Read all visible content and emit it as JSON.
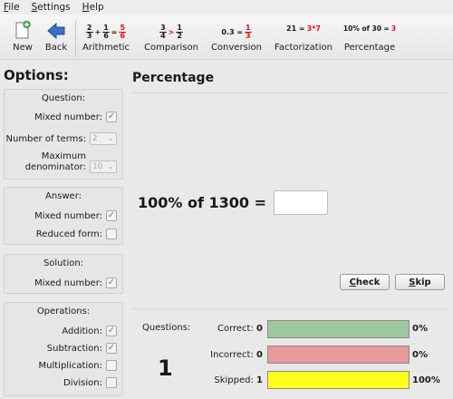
{
  "menu": {
    "file": "File",
    "settings": "Settings",
    "help": "Help"
  },
  "toolbar": {
    "new_label": "New",
    "back_label": "Back",
    "arithmetic_label": "Arithmetic",
    "comparison_label": "Comparison",
    "conversion_label": "Conversion",
    "factorization_label": "Factorization",
    "percentage_label": "Percentage",
    "arith_icon": {
      "a_num": "2",
      "a_den": "3",
      "op": "+",
      "b_num": "1",
      "b_den": "6",
      "eq": "=",
      "r_num": "5",
      "r_den": "6"
    },
    "comp_icon": {
      "a_num": "3",
      "a_den": "4",
      "op": ">",
      "b_num": "1",
      "b_den": "2"
    },
    "conv_icon": {
      "lhs": "0.3 =",
      "r_num": "1",
      "r_den": "3"
    },
    "fact_icon": {
      "lhs": "21 =",
      "rhs": "3*7"
    },
    "perc_icon": {
      "lhs": "10% of 30 =",
      "rhs": "3"
    }
  },
  "options": {
    "title": "Options:",
    "question": {
      "title": "Question:",
      "mixed_number_label": "Mixed number:",
      "num_terms_label": "Number of terms:",
      "num_terms_value": "2",
      "max_denominator_label_1": "Maximum",
      "max_denominator_label_2": "denominator:",
      "max_denominator_value": "10"
    },
    "answer": {
      "title": "Answer:",
      "mixed_number_label": "Mixed number:",
      "reduced_form_label": "Reduced form:"
    },
    "solution": {
      "title": "Solution:",
      "mixed_number_label": "Mixed number:"
    },
    "operations": {
      "title": "Operations:",
      "addition_label": "Addition:",
      "subtraction_label": "Subtraction:",
      "multiplication_label": "Multiplication:",
      "division_label": "Division:"
    }
  },
  "main": {
    "title": "Percentage",
    "problem": "100% of 1300 =",
    "answer_value": "",
    "check_label": "Check",
    "skip_label": "Skip"
  },
  "stats": {
    "questions_label": "Questions:",
    "questions_count": "1",
    "correct_label": "Correct:",
    "correct_count": "0",
    "correct_pct": "0%",
    "incorrect_label": "Incorrect:",
    "incorrect_count": "0",
    "incorrect_pct": "0%",
    "skipped_label": "Skipped:",
    "skipped_count": "1",
    "skipped_pct": "100%",
    "colors": {
      "correct": "#9ec89e",
      "incorrect": "#e79a9a",
      "skipped": "#ffff1a"
    }
  }
}
